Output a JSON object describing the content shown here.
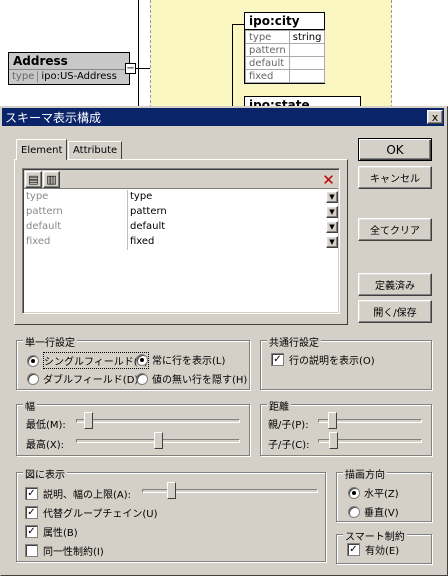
{
  "background": {
    "address_node": {
      "title": "Address",
      "row_key": "type",
      "row_value": "ipo:US-Address",
      "toggle": "−"
    },
    "city_node": {
      "title": "ipo:city",
      "rows": [
        {
          "key": "type",
          "value": "string"
        },
        {
          "key": "pattern",
          "value": ""
        },
        {
          "key": "default",
          "value": ""
        },
        {
          "key": "fixed",
          "value": ""
        }
      ]
    },
    "state_node": {
      "title": "ipo:state"
    }
  },
  "dialog": {
    "title": "スキーマ表示構成",
    "close": "x",
    "tabs": [
      {
        "label": "Element",
        "active": true
      },
      {
        "label": "Attribute",
        "active": false
      }
    ],
    "grid_rows": [
      {
        "key": "type",
        "value": "type"
      },
      {
        "key": "pattern",
        "value": "pattern"
      },
      {
        "key": "default",
        "value": "default"
      },
      {
        "key": "fixed",
        "value": "fixed"
      }
    ],
    "buttons": {
      "ok": "OK",
      "cancel": "キャンセル",
      "clear_all": "全てクリア",
      "predefined": "定義済み",
      "open_save": "開く/保存"
    },
    "single_line": {
      "legend": "単一行設定",
      "single_field": "シングルフィールド(S)",
      "double_field": "ダブルフィールド(D)",
      "always_show_row": "常に行を表示(L)",
      "hide_empty_rows": "値の無い行を隠す(H)"
    },
    "common_rows": {
      "legend": "共通行設定",
      "show_row_desc": "行の説明を表示(O)"
    },
    "width": {
      "legend": "幅",
      "min_label": "最低(M):",
      "max_label": "最高(X):",
      "min_level": 0.05,
      "max_level": 0.5
    },
    "distance": {
      "legend": "距離",
      "parent_child_label": "親/子(P):",
      "child_child_label": "子/子(C):",
      "parent_child_level": 0.1,
      "child_child_level": 0.12
    },
    "show_in_graph": {
      "legend": "図に表示",
      "items": [
        {
          "label": "説明、幅の上限(A):",
          "checked": true
        },
        {
          "label": "代替グループチェイン(U)",
          "checked": true
        },
        {
          "label": "属性(B)",
          "checked": true
        },
        {
          "label": "同一性制約(I)",
          "checked": false
        }
      ],
      "desc_width_level": 0.15
    },
    "draw_direction": {
      "legend": "描画方向",
      "horizontal": "水平(Z)",
      "vertical": "垂直(V)"
    },
    "smart_constraint": {
      "legend": "スマート制約",
      "enabled": "有効(E)"
    }
  }
}
